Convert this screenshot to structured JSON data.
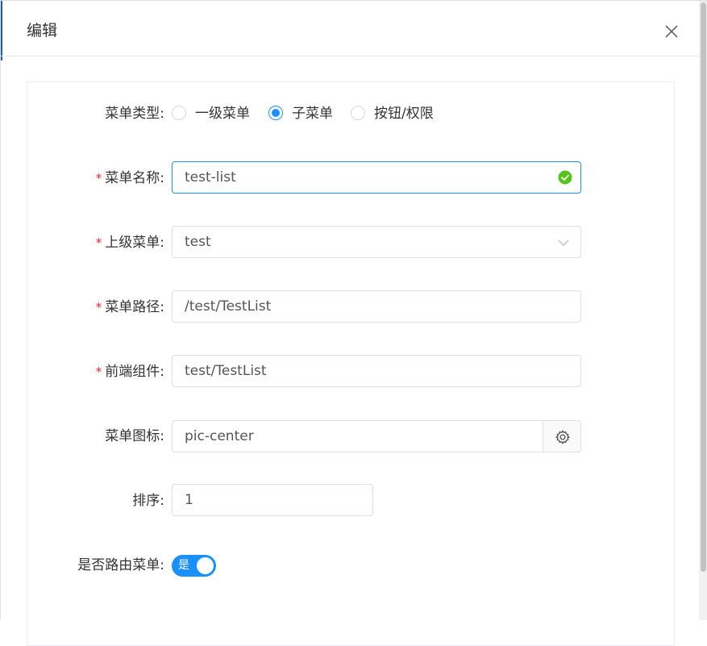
{
  "modal": {
    "title": "编辑"
  },
  "form": {
    "menu_type": {
      "label": "菜单类型:",
      "options": [
        "一级菜单",
        "子菜单",
        "按钮/权限"
      ],
      "selected": "子菜单"
    },
    "menu_name": {
      "label": "菜单名称:",
      "value": "test-list"
    },
    "parent_menu": {
      "label": "上级菜单:",
      "value": "test"
    },
    "menu_path": {
      "label": "菜单路径:",
      "value": "/test/TestList"
    },
    "frontend_component": {
      "label": "前端组件:",
      "value": "test/TestList"
    },
    "menu_icon": {
      "label": "菜单图标:",
      "value": "pic-center"
    },
    "sort_order": {
      "label": "排序:",
      "value": "1"
    },
    "is_route": {
      "label": "是否路由菜单:",
      "switch_text": "是"
    },
    "required_mark": "*"
  },
  "icons": {
    "close": "close-icon",
    "valid": "check-circle-icon",
    "dropdown": "chevron-down-icon",
    "settings": "gear-icon"
  },
  "colors": {
    "primary": "#1890ff",
    "success": "#52c41a",
    "required": "#f5222d",
    "accent": "#1d5ea8"
  }
}
